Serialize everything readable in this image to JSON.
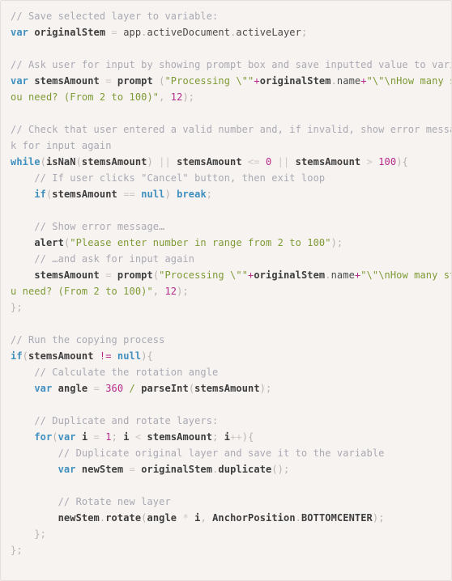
{
  "code_block": {
    "language": "javascript",
    "background_color": "#f7f3f1",
    "border_color": "#e6dedb",
    "theme_colors": {
      "comment": "#a9a9b3",
      "keyword": "#3f8fbf",
      "string": "#7d9a35",
      "number": "#b5298a",
      "identifier": "#3d3d3d",
      "punctuation": "#b9b2ae",
      "operator": "#b5298a"
    },
    "lines": [
      {
        "id": "l1",
        "text": "// Save selected layer to variable:"
      },
      {
        "id": "l2",
        "text": "var originalStem = app.activeDocument.activeLayer;"
      },
      {
        "id": "l3",
        "text": ""
      },
      {
        "id": "l4",
        "text": "// Ask user for input by showing prompt box and save inputted value to variable:"
      },
      {
        "id": "l5",
        "text": "var stemsAmount = prompt (\"Processing \\\"\"+originalStem.name+\"\\\"\\nHow many stems do y"
      },
      {
        "id": "l6",
        "text": "ou need? (From 2 to 100)\", 12);"
      },
      {
        "id": "l7",
        "text": ""
      },
      {
        "id": "l8",
        "text": "// Check that user entered a valid number and, if invalid, show error message and as"
      },
      {
        "id": "l9",
        "text": "k for input again"
      },
      {
        "id": "l10",
        "text": "while(isNaN(stemsAmount) || stemsAmount <= 0 || stemsAmount > 100){"
      },
      {
        "id": "l11",
        "text": "    // If user clicks \"Cancel\" button, then exit loop"
      },
      {
        "id": "l12",
        "text": "    if(stemsAmount == null) break;"
      },
      {
        "id": "l13",
        "text": ""
      },
      {
        "id": "l14",
        "text": "    // Show error message…"
      },
      {
        "id": "l15",
        "text": "    alert(\"Please enter number in range from 2 to 100\");"
      },
      {
        "id": "l16",
        "text": "    // …and ask for input again"
      },
      {
        "id": "l17",
        "text": "    stemsAmount = prompt(\"Processing \\\"\"+originalStem.name+\"\\\"\\nHow many stems do yo"
      },
      {
        "id": "l18",
        "text": "u need? (From 2 to 100)\", 12);"
      },
      {
        "id": "l19",
        "text": "};"
      },
      {
        "id": "l20",
        "text": ""
      },
      {
        "id": "l21",
        "text": "// Run the copying process"
      },
      {
        "id": "l22",
        "text": "if(stemsAmount != null){"
      },
      {
        "id": "l23",
        "text": "    // Calculate the rotation angle"
      },
      {
        "id": "l24",
        "text": "    var angle = 360 / parseInt(stemsAmount);"
      },
      {
        "id": "l25",
        "text": ""
      },
      {
        "id": "l26",
        "text": "    // Duplicate and rotate layers:"
      },
      {
        "id": "l27",
        "text": "    for(var i = 1; i < stemsAmount; i++){"
      },
      {
        "id": "l28",
        "text": "        // Duplicate original layer and save it to the variable"
      },
      {
        "id": "l29",
        "text": "        var newStem = originalStem.duplicate();"
      },
      {
        "id": "l30",
        "text": ""
      },
      {
        "id": "l31",
        "text": "        // Rotate new layer"
      },
      {
        "id": "l32",
        "text": "        newStem.rotate(angle * i, AnchorPosition.BOTTOMCENTER);"
      },
      {
        "id": "l33",
        "text": "    };"
      },
      {
        "id": "l34",
        "text": "};"
      }
    ],
    "tokens": {
      "l1": [
        [
          "comment",
          "// Save selected layer to variable:"
        ]
      ],
      "l2": [
        [
          "keyword",
          "var"
        ],
        [
          "plain",
          " "
        ],
        [
          "ident",
          "originalStem"
        ],
        [
          "plain",
          " "
        ],
        [
          "op-dim",
          "="
        ],
        [
          "plain",
          " "
        ],
        [
          "plain",
          "app"
        ],
        [
          "punct",
          "."
        ],
        [
          "plain",
          "activeDocument"
        ],
        [
          "punct",
          "."
        ],
        [
          "plain",
          "activeLayer"
        ],
        [
          "punct",
          ";"
        ]
      ],
      "l3": [],
      "l4": [
        [
          "comment",
          "// Ask user for input by showing prompt box and save inputted value to variable:"
        ]
      ],
      "l5": [
        [
          "keyword",
          "var"
        ],
        [
          "plain",
          " "
        ],
        [
          "ident",
          "stemsAmount"
        ],
        [
          "plain",
          " "
        ],
        [
          "op-dim",
          "="
        ],
        [
          "plain",
          " "
        ],
        [
          "ident",
          "prompt"
        ],
        [
          "plain",
          " "
        ],
        [
          "punct",
          "("
        ],
        [
          "string",
          "\"Processing \\\"\""
        ],
        [
          "op",
          "+"
        ],
        [
          "ident",
          "originalStem"
        ],
        [
          "punct",
          "."
        ],
        [
          "plain",
          "name"
        ],
        [
          "op",
          "+"
        ],
        [
          "string",
          "\"\\\"\\nHow many stems do y"
        ]
      ],
      "l6": [
        [
          "string",
          "ou need? (From 2 to 100)\""
        ],
        [
          "punct",
          ", "
        ],
        [
          "number",
          "12"
        ],
        [
          "punct",
          ");"
        ]
      ],
      "l7": [],
      "l8": [
        [
          "comment",
          "// Check that user entered a valid number and, if invalid, show error message and as"
        ]
      ],
      "l9": [
        [
          "comment",
          "k for input again"
        ]
      ],
      "l10": [
        [
          "keyword",
          "while"
        ],
        [
          "punct",
          "("
        ],
        [
          "ident",
          "isNaN"
        ],
        [
          "punct",
          "("
        ],
        [
          "ident",
          "stemsAmount"
        ],
        [
          "punct",
          ") "
        ],
        [
          "op-dim",
          "||"
        ],
        [
          "plain",
          " "
        ],
        [
          "ident",
          "stemsAmount"
        ],
        [
          "plain",
          " "
        ],
        [
          "op-dim",
          "<="
        ],
        [
          "plain",
          " "
        ],
        [
          "number",
          "0"
        ],
        [
          "plain",
          " "
        ],
        [
          "op-dim",
          "||"
        ],
        [
          "plain",
          " "
        ],
        [
          "ident",
          "stemsAmount"
        ],
        [
          "plain",
          " "
        ],
        [
          "op-dim",
          ">"
        ],
        [
          "plain",
          " "
        ],
        [
          "number",
          "100"
        ],
        [
          "punct",
          "){"
        ]
      ],
      "l11": [
        [
          "plain",
          "    "
        ],
        [
          "comment",
          "// If user clicks \"Cancel\" button, then exit loop"
        ]
      ],
      "l12": [
        [
          "plain",
          "    "
        ],
        [
          "keyword",
          "if"
        ],
        [
          "punct",
          "("
        ],
        [
          "ident",
          "stemsAmount"
        ],
        [
          "plain",
          " "
        ],
        [
          "op-dim",
          "=="
        ],
        [
          "plain",
          " "
        ],
        [
          "keyword",
          "null"
        ],
        [
          "punct",
          ") "
        ],
        [
          "keyword",
          "break"
        ],
        [
          "punct",
          ";"
        ]
      ],
      "l13": [],
      "l14": [
        [
          "plain",
          "    "
        ],
        [
          "comment",
          "// Show error message…"
        ]
      ],
      "l15": [
        [
          "plain",
          "    "
        ],
        [
          "ident",
          "alert"
        ],
        [
          "punct",
          "("
        ],
        [
          "string",
          "\"Please enter number in range from 2 to 100\""
        ],
        [
          "punct",
          ");"
        ]
      ],
      "l16": [
        [
          "plain",
          "    "
        ],
        [
          "comment",
          "// …and ask for input again"
        ]
      ],
      "l17": [
        [
          "plain",
          "    "
        ],
        [
          "ident",
          "stemsAmount"
        ],
        [
          "plain",
          " "
        ],
        [
          "op-dim",
          "="
        ],
        [
          "plain",
          " "
        ],
        [
          "ident",
          "prompt"
        ],
        [
          "punct",
          "("
        ],
        [
          "string",
          "\"Processing \\\"\""
        ],
        [
          "op",
          "+"
        ],
        [
          "ident",
          "originalStem"
        ],
        [
          "punct",
          "."
        ],
        [
          "plain",
          "name"
        ],
        [
          "op",
          "+"
        ],
        [
          "string",
          "\"\\\"\\nHow many stems do yo"
        ]
      ],
      "l18": [
        [
          "string",
          "u need? (From 2 to 100)\""
        ],
        [
          "punct",
          ", "
        ],
        [
          "number",
          "12"
        ],
        [
          "punct",
          ");"
        ]
      ],
      "l19": [
        [
          "punct",
          "};"
        ]
      ],
      "l20": [],
      "l21": [
        [
          "comment",
          "// Run the copying process"
        ]
      ],
      "l22": [
        [
          "keyword",
          "if"
        ],
        [
          "punct",
          "("
        ],
        [
          "ident",
          "stemsAmount"
        ],
        [
          "plain",
          " "
        ],
        [
          "op",
          "!="
        ],
        [
          "plain",
          " "
        ],
        [
          "keyword",
          "null"
        ],
        [
          "punct",
          "){"
        ]
      ],
      "l23": [
        [
          "plain",
          "    "
        ],
        [
          "comment",
          "// Calculate the rotation angle"
        ]
      ],
      "l24": [
        [
          "plain",
          "    "
        ],
        [
          "keyword",
          "var"
        ],
        [
          "plain",
          " "
        ],
        [
          "ident",
          "angle"
        ],
        [
          "plain",
          " "
        ],
        [
          "op-dim",
          "="
        ],
        [
          "plain",
          " "
        ],
        [
          "number",
          "360"
        ],
        [
          "plain",
          " "
        ],
        [
          "string",
          "/"
        ],
        [
          "plain",
          " "
        ],
        [
          "ident",
          "parseInt"
        ],
        [
          "punct",
          "("
        ],
        [
          "ident",
          "stemsAmount"
        ],
        [
          "punct",
          ");"
        ]
      ],
      "l25": [],
      "l26": [
        [
          "plain",
          "    "
        ],
        [
          "comment",
          "// Duplicate and rotate layers:"
        ]
      ],
      "l27": [
        [
          "plain",
          "    "
        ],
        [
          "keyword",
          "for"
        ],
        [
          "punct",
          "("
        ],
        [
          "keyword",
          "var"
        ],
        [
          "plain",
          " "
        ],
        [
          "ident",
          "i"
        ],
        [
          "plain",
          " "
        ],
        [
          "op-dim",
          "="
        ],
        [
          "plain",
          " "
        ],
        [
          "number",
          "1"
        ],
        [
          "punct",
          "; "
        ],
        [
          "ident",
          "i"
        ],
        [
          "plain",
          " "
        ],
        [
          "op-dim",
          "<"
        ],
        [
          "plain",
          " "
        ],
        [
          "ident",
          "stemsAmount"
        ],
        [
          "punct",
          "; "
        ],
        [
          "ident",
          "i"
        ],
        [
          "op-dim",
          "++"
        ],
        [
          "punct",
          "){"
        ]
      ],
      "l28": [
        [
          "plain",
          "        "
        ],
        [
          "comment",
          "// Duplicate original layer and save it to the variable"
        ]
      ],
      "l29": [
        [
          "plain",
          "        "
        ],
        [
          "keyword",
          "var"
        ],
        [
          "plain",
          " "
        ],
        [
          "ident",
          "newStem"
        ],
        [
          "plain",
          " "
        ],
        [
          "op-dim",
          "="
        ],
        [
          "plain",
          " "
        ],
        [
          "ident",
          "originalStem"
        ],
        [
          "punct",
          "."
        ],
        [
          "ident",
          "duplicate"
        ],
        [
          "punct",
          "();"
        ]
      ],
      "l30": [],
      "l31": [
        [
          "plain",
          "        "
        ],
        [
          "comment",
          "// Rotate new layer"
        ]
      ],
      "l32": [
        [
          "plain",
          "        "
        ],
        [
          "ident",
          "newStem"
        ],
        [
          "punct",
          "."
        ],
        [
          "ident",
          "rotate"
        ],
        [
          "punct",
          "("
        ],
        [
          "ident",
          "angle"
        ],
        [
          "plain",
          " "
        ],
        [
          "op-dim",
          "*"
        ],
        [
          "plain",
          " "
        ],
        [
          "ident",
          "i"
        ],
        [
          "punct",
          ", "
        ],
        [
          "ident",
          "AnchorPosition"
        ],
        [
          "punct",
          "."
        ],
        [
          "ident",
          "BOTTOMCENTER"
        ],
        [
          "punct",
          ");"
        ]
      ],
      "l33": [
        [
          "plain",
          "    "
        ],
        [
          "punct",
          "};"
        ]
      ],
      "l34": [
        [
          "punct",
          "};"
        ]
      ]
    }
  }
}
